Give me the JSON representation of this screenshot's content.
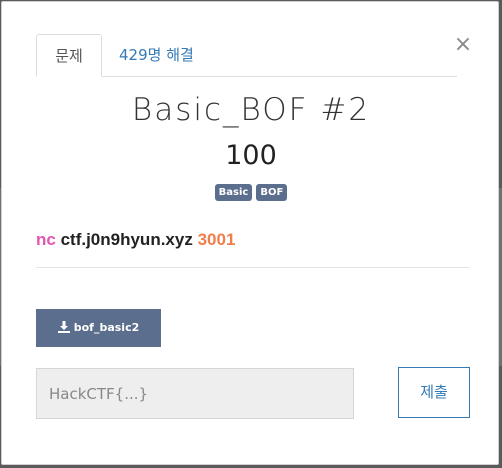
{
  "tabs": {
    "challenge_label": "문제",
    "solves_label": "429명 해결"
  },
  "close_glyph": "×",
  "challenge": {
    "title": "Basic_BOF #2",
    "points": "100",
    "tags": [
      "Basic",
      "BOF"
    ],
    "description": {
      "command": "nc",
      "host": "ctf.j0n9hyun.xyz",
      "port": "3001"
    }
  },
  "download": {
    "icon": "download-icon",
    "label": "bof_basic2"
  },
  "flag": {
    "placeholder": "HackCTF{...}",
    "value": ""
  },
  "submit_label": "제출",
  "colors": {
    "accent": "#337ab7",
    "tag_bg": "#5b6e8d",
    "nc_color": "#e357b2",
    "port_color": "#f07e4a"
  }
}
